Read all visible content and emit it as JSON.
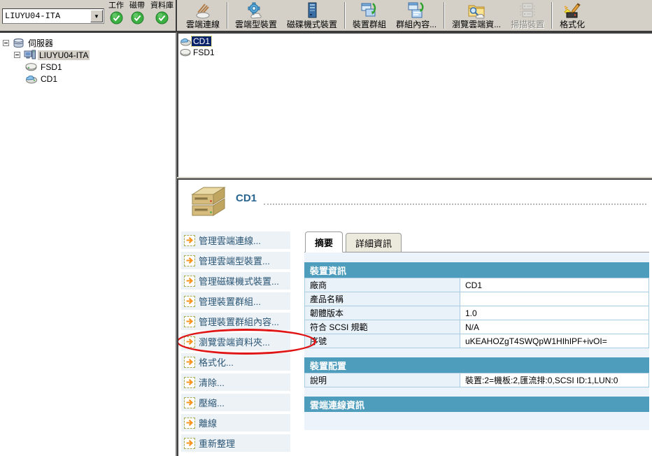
{
  "colors": {
    "section_header": "#4f9dbd",
    "selection": "#0a246a",
    "annotation_red": "#e01515",
    "status_green": "#3cb043",
    "title_blue": "#27648f",
    "menu_item_bg": "#edf2f7",
    "arrow_orange": "#f7941d"
  },
  "topbar": {
    "server_selector": {
      "value": "LIUYU04-ITA",
      "icon": "chevron-down-icon"
    },
    "statuses": [
      {
        "label": "工作",
        "icon": "check-circle-icon",
        "state": "ok"
      },
      {
        "label": "磁帶",
        "icon": "check-circle-icon",
        "state": "ok"
      },
      {
        "label": "資料庫",
        "icon": "check-circle-icon",
        "state": "ok"
      }
    ]
  },
  "toolbar": {
    "buttons": [
      {
        "label": "雲端連線",
        "icon": "cloud-connect-icon",
        "disabled": false
      },
      {
        "label": "雲端型裝置",
        "icon": "cloud-device-icon",
        "disabled": false
      },
      {
        "label": "磁碟機式裝置",
        "icon": "disk-device-icon",
        "disabled": false
      },
      {
        "label": "裝置群組",
        "icon": "device-group-icon",
        "disabled": false
      },
      {
        "label": "群組內容...",
        "icon": "group-properties-icon",
        "disabled": false
      },
      {
        "label": "瀏覽雲端資...",
        "icon": "browse-cloud-folder-icon",
        "disabled": false
      },
      {
        "label": "掃描裝置",
        "icon": "scan-device-icon",
        "disabled": true
      },
      {
        "label": "格式化",
        "icon": "format-icon",
        "disabled": false
      }
    ]
  },
  "tree": {
    "nodes": [
      {
        "label": "伺服器",
        "icon": "servers-icon",
        "level": 0,
        "expanded": true,
        "selected": false
      },
      {
        "label": "LIUYU04-ITA",
        "icon": "server-computer-icon",
        "level": 1,
        "expanded": true,
        "selected": true
      },
      {
        "label": "FSD1",
        "icon": "disk-icon",
        "level": 2,
        "selected": false
      },
      {
        "label": "CD1",
        "icon": "cloud-disk-icon",
        "level": 2,
        "selected": false
      }
    ]
  },
  "device_list": {
    "items": [
      {
        "label": "CD1",
        "icon": "cloud-disk-icon",
        "selected": true
      },
      {
        "label": "FSD1",
        "icon": "disk-icon",
        "selected": false
      }
    ]
  },
  "detail": {
    "title": "CD1",
    "title_icon": "drive-stack-icon",
    "tabs": [
      {
        "label": "摘要",
        "active": true
      },
      {
        "label": "詳細資訊",
        "active": false
      }
    ],
    "menu": {
      "items": [
        {
          "label": "管理雲端連線...",
          "annotated": false
        },
        {
          "label": "管理雲端型裝置...",
          "annotated": false
        },
        {
          "label": "管理磁碟機式裝置...",
          "annotated": false
        },
        {
          "label": "管理裝置群組...",
          "annotated": false
        },
        {
          "label": "管理裝置群組內容...",
          "annotated": false
        },
        {
          "label": "瀏覽雲端資料夾...",
          "annotated": true
        },
        {
          "label": "格式化...",
          "annotated": false
        },
        {
          "label": "清除...",
          "annotated": false
        },
        {
          "label": "壓縮...",
          "annotated": false
        },
        {
          "label": "離線",
          "annotated": false
        },
        {
          "label": "重新整理",
          "annotated": false
        }
      ]
    },
    "annotation": {
      "shape": "ellipse",
      "color": "#e01515",
      "target": "瀏覽雲端資料夾..."
    },
    "sections": [
      {
        "title": "裝置資訊",
        "rows": [
          {
            "label": "廠商",
            "value": "CD1"
          },
          {
            "label": "產品名稱",
            "value": ""
          },
          {
            "label": "韌體版本",
            "value": "1.0"
          },
          {
            "label": "符合 SCSI 規範",
            "value": "N/A"
          },
          {
            "label": "序號",
            "value": "uKEAHOZgT4SWQpW1HIhIPF+ivOI="
          }
        ]
      },
      {
        "title": "裝置配置",
        "rows": [
          {
            "label": "說明",
            "value": "裝置:2=機板:2,匯流排:0,SCSI ID:1,LUN:0"
          }
        ]
      },
      {
        "title": "雲端連線資訊",
        "rows": []
      }
    ]
  }
}
